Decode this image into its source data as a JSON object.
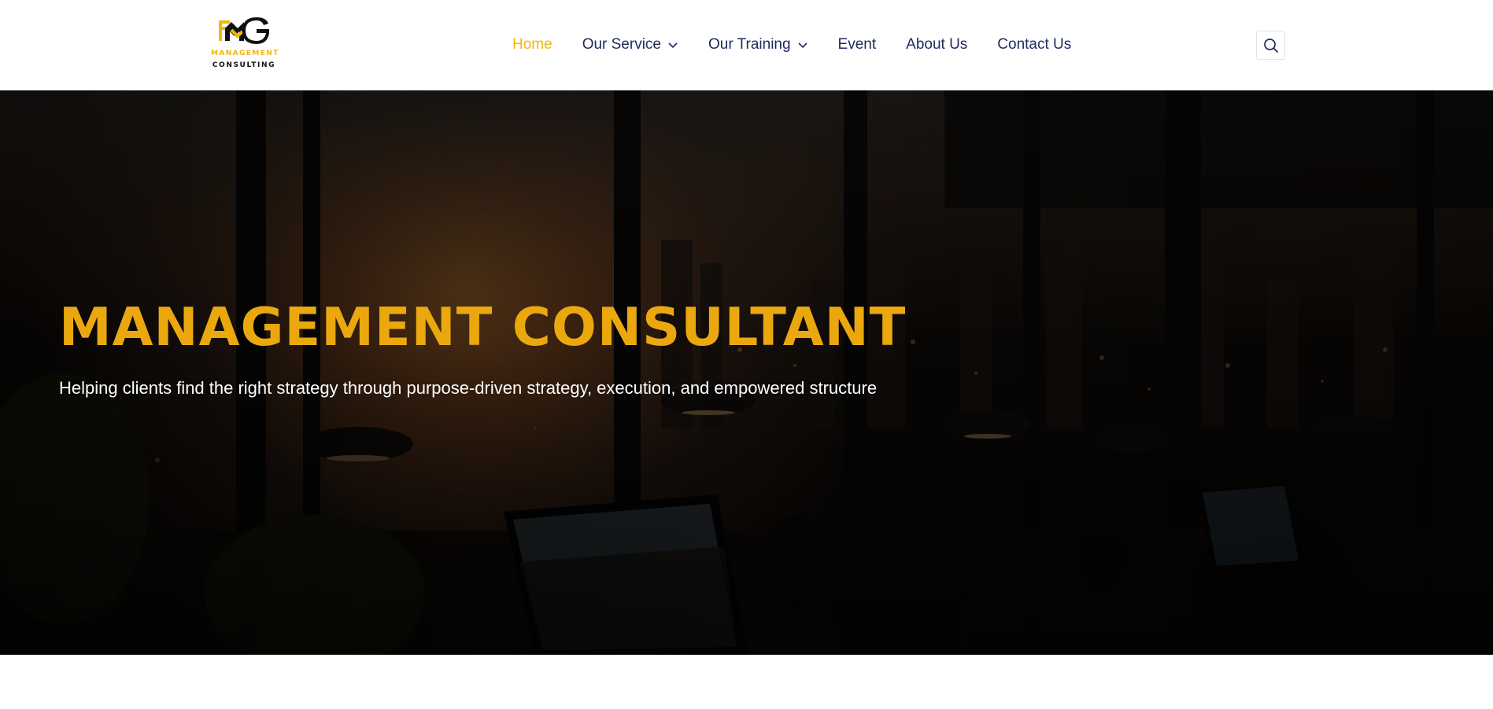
{
  "header": {
    "logo": {
      "mark": "PMG",
      "line1": "MANAGEMENT",
      "line2": "CONSULTING"
    },
    "nav": [
      {
        "label": "Home",
        "active": true
      },
      {
        "label": "Our Service",
        "dropdown": true
      },
      {
        "label": "Our Training",
        "dropdown": true
      },
      {
        "label": "Event"
      },
      {
        "label": "About Us"
      },
      {
        "label": "Contact Us"
      }
    ],
    "search_icon": "search-icon"
  },
  "hero": {
    "title": "MANAGEMENT CONSULTANT",
    "subtitle": "Helping clients find the right strategy through purpose-driven strategy, execution, and empowered structure"
  },
  "colors": {
    "accent": "#F2B705",
    "hero_title": "#EBA80E",
    "nav_text": "#1F2A5C",
    "hero_text": "#FFFFFF"
  }
}
